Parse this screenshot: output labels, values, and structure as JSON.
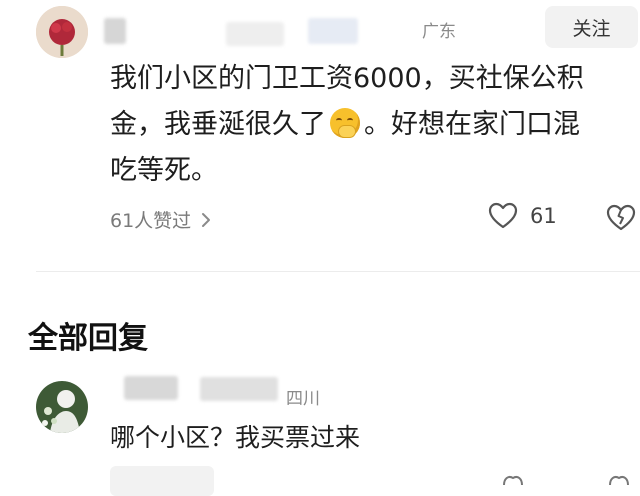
{
  "post": {
    "location": "广东",
    "follow_label": "关注",
    "text_line1": "我们小区的门卫工资6000，买社保公积",
    "text_line2_a": "金，我垂涎很久了",
    "text_line2_b": "。好想在家门口混",
    "text_line3": "吃等死。",
    "likers_label": "61人赞过",
    "like_count": "61"
  },
  "replies": {
    "section_title": "全部回复",
    "items": [
      {
        "location": "四川",
        "text": "哪个小区？我买票过来"
      }
    ]
  },
  "colors": {
    "accent_avatar": "#b0283a",
    "meta_text": "#8a8a8a",
    "follow_bg": "#f2f2f2"
  },
  "icons": [
    "chevron-right-icon",
    "like-heart-icon",
    "broken-heart-icon",
    "smiling-face-with-hand-over-mouth-emoji"
  ]
}
